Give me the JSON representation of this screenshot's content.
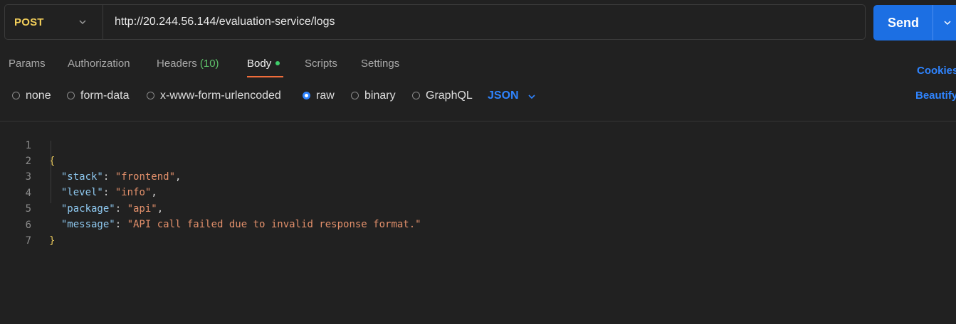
{
  "request": {
    "method": "POST",
    "url": "http://20.244.56.144/evaluation-service/logs",
    "send_label": "Send"
  },
  "tabs": [
    {
      "label": "Params"
    },
    {
      "label": "Authorization"
    },
    {
      "label": "Headers",
      "count": "(10)"
    },
    {
      "label": "Body",
      "active": true
    },
    {
      "label": "Scripts"
    },
    {
      "label": "Settings"
    }
  ],
  "links": {
    "cookies": "Cookies",
    "beautify": "Beautify"
  },
  "body_modes": [
    {
      "label": "none"
    },
    {
      "label": "form-data"
    },
    {
      "label": "x-www-form-urlencoded"
    },
    {
      "label": "raw",
      "checked": true
    },
    {
      "label": "binary"
    },
    {
      "label": "GraphQL"
    }
  ],
  "format": "JSON",
  "editor": {
    "line_numbers": [
      "1",
      "2",
      "3",
      "4",
      "5",
      "6",
      "7"
    ],
    "open_brace": "{",
    "close_brace": "}",
    "entries": [
      {
        "key": "\"stack\"",
        "value": "\"frontend\""
      },
      {
        "key": "\"level\"",
        "value": "\"info\""
      },
      {
        "key": "\"package\"",
        "value": "\"api\""
      },
      {
        "key": "\"message\"",
        "value": "\"API call failed due to invalid response format.\""
      }
    ]
  },
  "colors": {
    "accent": "#1c6fe3",
    "method": "#f3cf5a",
    "active_tab_underline": "#ef6c3a",
    "link": "#2f84ff"
  }
}
